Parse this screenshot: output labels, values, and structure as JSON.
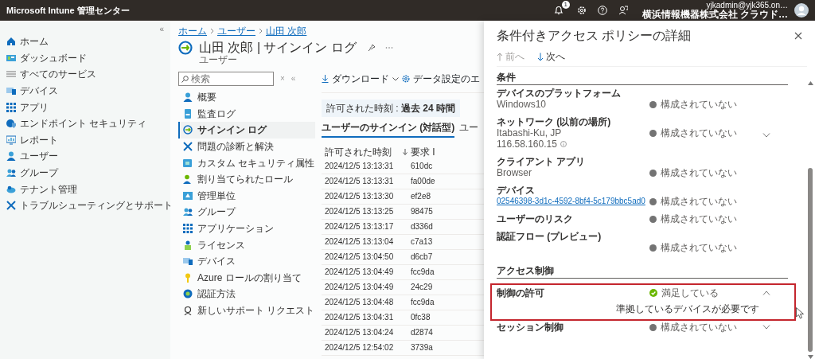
{
  "app_bar": {
    "title": "Microsoft Intune 管理センター",
    "notification_count": "1",
    "account": {
      "email": "yjkadmin@yjk365.on…",
      "org": "横浜情報機器株式会社 クラウド…"
    }
  },
  "sidebar": {
    "collapse": "«",
    "items": [
      {
        "label": "ホーム",
        "selected": false
      },
      {
        "label": "ダッシュボード",
        "selected": false
      },
      {
        "label": "すべてのサービス",
        "selected": false
      },
      {
        "label": "デバイス",
        "selected": false
      },
      {
        "label": "アプリ",
        "selected": false
      },
      {
        "label": "エンドポイント セキュリティ",
        "selected": false
      },
      {
        "label": "レポート",
        "selected": false
      },
      {
        "label": "ユーザー",
        "selected": false
      },
      {
        "label": "グループ",
        "selected": false
      },
      {
        "label": "テナント管理",
        "selected": false
      },
      {
        "label": "トラブルシューティングとサポート",
        "selected": false
      }
    ]
  },
  "breadcrumb": [
    "ホーム",
    "ユーザー",
    "山田 次郎"
  ],
  "blade": {
    "title": "山田 次郎 | サインイン ログ",
    "subtitle": "ユーザー"
  },
  "resource_menu": {
    "search": {
      "placeholder": "検索"
    },
    "clear": "×",
    "collapse": "«",
    "items": [
      {
        "label": "概要",
        "selected": false
      },
      {
        "label": "監査ログ",
        "selected": false
      },
      {
        "label": "サインイン ログ",
        "selected": true
      },
      {
        "label": "問題の診断と解決",
        "selected": false
      },
      {
        "label": "カスタム セキュリティ属性",
        "selected": false
      },
      {
        "label": "割り当てられたロール",
        "selected": false
      },
      {
        "label": "管理単位",
        "selected": false
      },
      {
        "label": "グループ",
        "selected": false
      },
      {
        "label": "アプリケーション",
        "selected": false
      },
      {
        "label": "ライセンス",
        "selected": false
      },
      {
        "label": "デバイス",
        "selected": false
      },
      {
        "label": "Azure ロールの割り当て",
        "selected": false
      },
      {
        "label": "認証方法",
        "selected": false
      },
      {
        "label": "新しいサポート リクエスト",
        "selected": false
      }
    ]
  },
  "toolbar": [
    "ダウンロード",
    "データ設定のエ"
  ],
  "filter": "許可された時刻 : **過去 24 時間**",
  "tabs": [
    {
      "label": "ユーザーのサインイン (対話型)",
      "selected": true
    },
    {
      "label": "ユー",
      "selected": false
    }
  ],
  "table": {
    "columns": [
      "許可された時刻",
      "要求 I"
    ],
    "rows": [
      [
        "2024/12/5 13:13:31",
        "610dc"
      ],
      [
        "2024/12/5 13:13:31",
        "fa00de"
      ],
      [
        "2024/12/5 13:13:30",
        "ef2e8"
      ],
      [
        "2024/12/5 13:13:25",
        "98475"
      ],
      [
        "2024/12/5 13:13:17",
        "d336d"
      ],
      [
        "2024/12/5 13:13:04",
        "c7a13"
      ],
      [
        "2024/12/5 13:04:50",
        "d6cb7"
      ],
      [
        "2024/12/5 13:04:49",
        "fcc9da"
      ],
      [
        "2024/12/5 13:04:49",
        "24c29"
      ],
      [
        "2024/12/5 13:04:48",
        "fcc9da"
      ],
      [
        "2024/12/5 13:04:31",
        "0fc38"
      ],
      [
        "2024/12/5 13:04:24",
        "d2874"
      ],
      [
        "2024/12/5 12:54:02",
        "3739a"
      ]
    ]
  },
  "panel": {
    "title": "条件付きアクセス ポリシーの詳細",
    "nav": [
      {
        "label": "前へ",
        "disabled": true
      },
      {
        "label": "次へ",
        "disabled": false
      }
    ],
    "sections": [
      {
        "heading": "条件",
        "rows": [
          {
            "label": "デバイスのプラットフォーム",
            "values": [
              {
                "text": "Windows10",
                "kind": "text"
              }
            ],
            "status": {
              "text": "構成されていない",
              "satisfied": false
            }
          },
          {
            "label": "ネットワーク (以前の場所)",
            "values": [
              {
                "text": "Itabashi-Ku, JP",
                "kind": "text"
              },
              {
                "text": "116.58.160.15",
                "kind": "info"
              }
            ],
            "status": {
              "text": "構成されていない",
              "satisfied": false
            },
            "expanded": false
          },
          {
            "label": "クライアント アプリ",
            "values": [
              {
                "text": "Browser",
                "kind": "text"
              }
            ],
            "status": {
              "text": "構成されていない",
              "satisfied": false
            }
          },
          {
            "label": "デバイス",
            "values": [
              {
                "text": "02546398-3d1c-4592-8bf4-5c179bbc5ad0",
                "kind": "link"
              }
            ],
            "status": {
              "text": "構成されていない",
              "satisfied": false
            }
          },
          {
            "label": "ユーザーのリスク",
            "status": {
              "text": "構成されていない",
              "satisfied": false
            }
          },
          {
            "label": "認証フロー (プレビュー)",
            "status": {
              "text": "構成されていない",
              "satisfied": false
            }
          }
        ]
      },
      {
        "heading": "アクセス制御",
        "rows": [
          {
            "label": "制御の許可",
            "status": {
              "text": "満足している",
              "satisfied": true
            },
            "expanded": true,
            "highlighted": true,
            "detail": "準拠しているデバイスが必要です"
          },
          {
            "label": "セッション制御",
            "status": {
              "text": "構成されていない",
              "satisfied": false
            },
            "expanded": false
          }
        ]
      }
    ]
  }
}
